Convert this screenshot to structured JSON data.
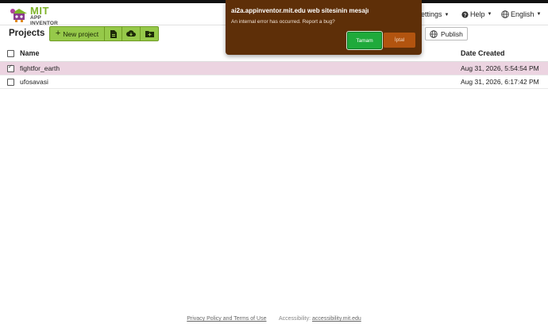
{
  "header": {
    "logo_mit": "MIT",
    "logo_sub": "APP INVENTOR",
    "settings": "ettings",
    "help": "Help",
    "language": "English"
  },
  "toolbar": {
    "title": "Projects",
    "new_project": "New project",
    "publish": "Publish"
  },
  "table": {
    "headers": {
      "name": "Name",
      "date": "Date Created"
    },
    "rows": [
      {
        "name": "fightfor_earth",
        "date": "Aug 31, 2026, 5:54:54 PM",
        "checked": true
      },
      {
        "name": "ufosavasi",
        "date": "Aug 31, 2026, 6:17:42 PM",
        "checked": false
      }
    ]
  },
  "dialog": {
    "title": "ai2a.appinventor.mit.edu web sitesinin mesajı",
    "message": "An internal error has occurred. Report a bug?",
    "ok": "Tamam",
    "cancel": "İptal"
  },
  "footer": {
    "privacy": "Privacy Policy and Terms of Use",
    "accessibility_label": "Accessibility:",
    "accessibility_link": "accessibility.mit.edu"
  },
  "colors": {
    "accent_green": "#96c94a",
    "selected_row": "#ecd4e1",
    "dialog_bg": "#5e2f08",
    "ok_button": "#1faa3b",
    "cancel_button": "#b2540f"
  }
}
